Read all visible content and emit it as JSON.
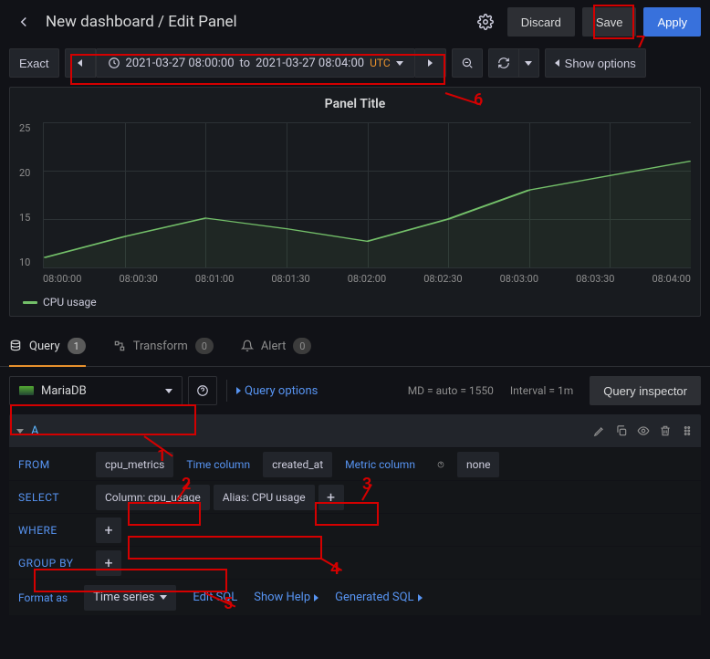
{
  "header": {
    "title": "New dashboard / Edit Panel",
    "discard": "Discard",
    "save": "Save",
    "apply": "Apply"
  },
  "toolbar": {
    "exact": "Exact",
    "timerange_from": "2021-03-27 08:00:00",
    "timerange_to": "to",
    "timerange_end": "2021-03-27 08:04:00",
    "tz": "UTC",
    "show_options": "Show options"
  },
  "panel": {
    "title": "Panel Title",
    "legend": "CPU usage"
  },
  "chart_data": {
    "type": "line",
    "title": "Panel Title",
    "x": [
      "08:00:00",
      "08:00:30",
      "08:01:00",
      "08:01:30",
      "08:02:00",
      "08:02:30",
      "08:03:00",
      "08:03:30",
      "08:04:00"
    ],
    "series": [
      {
        "name": "CPU usage",
        "color": "#73bf69",
        "values": [
          11,
          13.2,
          15.1,
          14,
          12.7,
          15,
          18,
          19.5,
          21
        ]
      }
    ],
    "ylim": [
      10,
      25
    ],
    "yticks": [
      10,
      15,
      20,
      25
    ],
    "xlabel": "",
    "ylabel": ""
  },
  "tabs": {
    "query": "Query",
    "query_count": "1",
    "transform": "Transform",
    "transform_count": "0",
    "alert": "Alert",
    "alert_count": "0"
  },
  "datasource": {
    "name": "MariaDB",
    "query_options": "Query options",
    "md": "MD = auto = 1550",
    "interval": "Interval = 1m",
    "inspector": "Query inspector"
  },
  "queryA": {
    "id": "A",
    "from_label": "FROM",
    "from_table": "cpu_metrics",
    "time_col_label": "Time column",
    "time_col_value": "created_at",
    "metric_col_label": "Metric column",
    "metric_col_value": "none",
    "select_label": "SELECT",
    "select_column": "Column: cpu_usage",
    "select_alias": "Alias: CPU usage",
    "where_label": "WHERE",
    "groupby_label": "GROUP BY",
    "format_as_label": "Format as",
    "format_as_value": "Time series",
    "edit_sql": "Edit SQL",
    "show_help": "Show Help",
    "generated_sql": "Generated SQL"
  },
  "annotations": {
    "1": "1",
    "2": "2",
    "3": "3",
    "4": "4",
    "5": "5",
    "6": "6",
    "7": "7"
  }
}
